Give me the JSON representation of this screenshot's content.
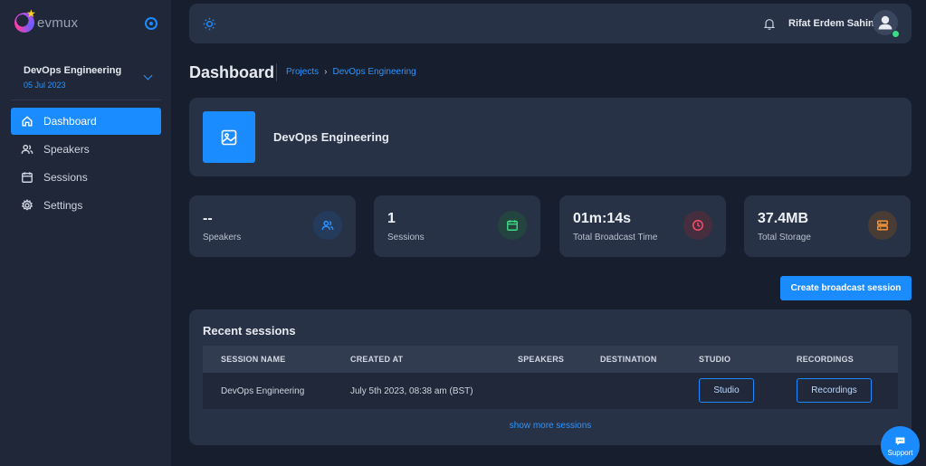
{
  "app": {
    "logo_text": "evmux"
  },
  "project": {
    "name": "DevOps Engineering",
    "date": "05 Jul 2023"
  },
  "nav": [
    {
      "label": "Dashboard",
      "icon": "home-icon",
      "active": true
    },
    {
      "label": "Speakers",
      "icon": "users-icon",
      "active": false
    },
    {
      "label": "Sessions",
      "icon": "calendar-icon",
      "active": false
    },
    {
      "label": "Settings",
      "icon": "gear-icon",
      "active": false
    }
  ],
  "topbar": {
    "user_name": "Rifat Erdem Sahin",
    "theme_icon": "sun-icon",
    "notification_icon": "bell-icon",
    "status_color": "#3ddc84"
  },
  "page": {
    "title": "Dashboard",
    "breadcrumb": [
      "Projects",
      "DevOps Engineering"
    ],
    "breadcrumb_separator": "›"
  },
  "banner": {
    "title": "DevOps Engineering",
    "icon": "image-icon"
  },
  "stats": [
    {
      "value": "--",
      "label": "Speakers",
      "icon": "users-icon",
      "color": "#2b95ff"
    },
    {
      "value": "1",
      "label": "Sessions",
      "icon": "calendar-icon",
      "color": "#3ddc84"
    },
    {
      "value": "01m:14s",
      "label": "Total Broadcast Time",
      "icon": "clock-icon",
      "color": "#ff4d6a"
    },
    {
      "value": "37.4MB",
      "label": "Total Storage",
      "icon": "storage-icon",
      "color": "#ff9a3c"
    }
  ],
  "actions": {
    "create_label": "Create broadcast session"
  },
  "recent": {
    "title": "Recent sessions",
    "columns": [
      "SESSION NAME",
      "CREATED AT",
      "SPEAKERS",
      "DESTINATION",
      "STUDIO",
      "RECORDINGS"
    ],
    "rows": [
      {
        "name": "DevOps Engineering",
        "created": "July 5th 2023, 08:38 am (BST)",
        "speakers": "",
        "destination": "",
        "studio_label": "Studio",
        "recordings_label": "Recordings"
      }
    ],
    "show_more": "show more sessions"
  },
  "support": {
    "label": "Support"
  },
  "colors": {
    "accent": "#1b8cff",
    "sidebar": "#1f2738",
    "card": "#283246",
    "background": "#171e2e"
  }
}
